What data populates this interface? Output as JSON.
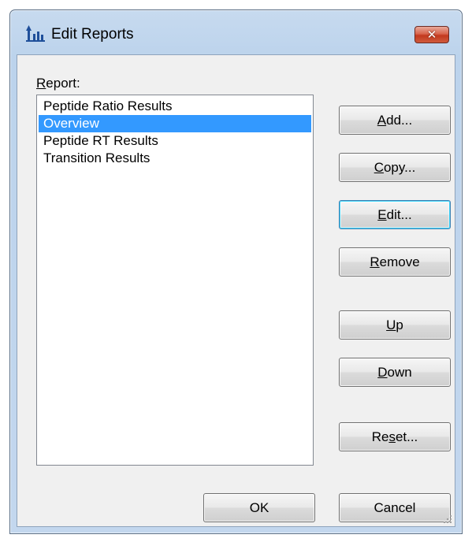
{
  "window": {
    "title": "Edit Reports",
    "close_symbol": "✕"
  },
  "report_list": {
    "label_mnemonic": "R",
    "label_rest": "eport:",
    "items": [
      "Peptide Ratio Results",
      "Overview",
      "Peptide RT Results",
      "Transition Results"
    ],
    "selected_index": 1
  },
  "buttons": {
    "add": {
      "mnemonic": "A",
      "rest": "dd..."
    },
    "copy": {
      "mnemonic": "C",
      "rest": "opy..."
    },
    "edit": {
      "mnemonic": "E",
      "rest": "dit..."
    },
    "remove": {
      "mnemonic": "R",
      "rest": "emove"
    },
    "up": {
      "mnemonic": "U",
      "rest": "p"
    },
    "down": {
      "mnemonic": "D",
      "rest": "own"
    },
    "reset": {
      "pre": "Re",
      "mnemonic": "s",
      "rest": "et..."
    },
    "ok": "OK",
    "cancel": "Cancel"
  },
  "colors": {
    "selection": "#3399ff",
    "title_bar": "#c7daef",
    "close_button": "#c7422a"
  },
  "icons": {
    "app": "skyline-app-icon",
    "close": "close-icon",
    "resize": "resize-grip-icon"
  }
}
